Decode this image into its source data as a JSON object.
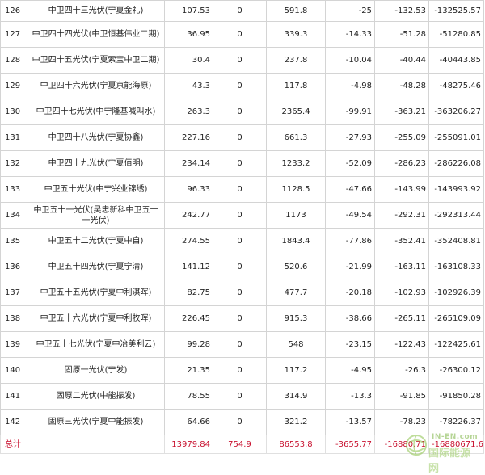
{
  "rows": [
    {
      "id": "126",
      "name": "中卫四十三光伏(宁夏金礼)",
      "capacity": "107.53",
      "zero": "0",
      "val": "591.8",
      "d1": "-25",
      "d2": "-132.53",
      "d3": "-132525.57"
    },
    {
      "id": "127",
      "name": "中卫四十四光伏(中卫恒基伟业二期)",
      "capacity": "36.95",
      "zero": "0",
      "val": "339.3",
      "d1": "-14.33",
      "d2": "-51.28",
      "d3": "-51280.85"
    },
    {
      "id": "128",
      "name": "中卫四十五光伏(宁夏索宝中卫二期)",
      "capacity": "30.4",
      "zero": "0",
      "val": "237.8",
      "d1": "-10.04",
      "d2": "-40.44",
      "d3": "-40443.85"
    },
    {
      "id": "129",
      "name": "中卫四十六光伏(宁夏京能海原)",
      "capacity": "43.3",
      "zero": "0",
      "val": "117.8",
      "d1": "-4.98",
      "d2": "-48.28",
      "d3": "-48275.46"
    },
    {
      "id": "130",
      "name": "中卫四十七光伏(中宁隆基喊叫水)",
      "capacity": "263.3",
      "zero": "0",
      "val": "2365.4",
      "d1": "-99.91",
      "d2": "-363.21",
      "d3": "-363206.27"
    },
    {
      "id": "131",
      "name": "中卫四十八光伏(宁夏协鑫)",
      "capacity": "227.16",
      "zero": "0",
      "val": "661.3",
      "d1": "-27.93",
      "d2": "-255.09",
      "d3": "-255091.01"
    },
    {
      "id": "132",
      "name": "中卫四十九光伏(宁夏佰明)",
      "capacity": "234.14",
      "zero": "0",
      "val": "1233.2",
      "d1": "-52.09",
      "d2": "-286.23",
      "d3": "-286226.08"
    },
    {
      "id": "133",
      "name": "中卫五十光伏(中宁兴业锦绣)",
      "capacity": "96.33",
      "zero": "0",
      "val": "1128.5",
      "d1": "-47.66",
      "d2": "-143.99",
      "d3": "-143993.92"
    },
    {
      "id": "134",
      "name": "中卫五十一光伏(吴忠新科中卫五十一光伏)",
      "capacity": "242.77",
      "zero": "0",
      "val": "1173",
      "d1": "-49.54",
      "d2": "-292.31",
      "d3": "-292313.44"
    },
    {
      "id": "135",
      "name": "中卫五十二光伏(宁夏中自)",
      "capacity": "274.55",
      "zero": "0",
      "val": "1843.4",
      "d1": "-77.86",
      "d2": "-352.41",
      "d3": "-352408.81"
    },
    {
      "id": "136",
      "name": "中卫五十四光伏(宁夏宁清)",
      "capacity": "141.12",
      "zero": "0",
      "val": "520.6",
      "d1": "-21.99",
      "d2": "-163.11",
      "d3": "-163108.33"
    },
    {
      "id": "137",
      "name": "中卫五十五光伏(宁夏中利淇晖)",
      "capacity": "82.75",
      "zero": "0",
      "val": "477.7",
      "d1": "-20.18",
      "d2": "-102.93",
      "d3": "-102926.39"
    },
    {
      "id": "138",
      "name": "中卫五十六光伏(宁夏中利牧晖)",
      "capacity": "226.45",
      "zero": "0",
      "val": "915.3",
      "d1": "-38.66",
      "d2": "-265.11",
      "d3": "-265109.09"
    },
    {
      "id": "139",
      "name": "中卫五十七光伏(宁夏中冶美利云)",
      "capacity": "99.28",
      "zero": "0",
      "val": "548",
      "d1": "-23.15",
      "d2": "-122.43",
      "d3": "-122425.61"
    },
    {
      "id": "140",
      "name": "固原一光伏(宁发)",
      "capacity": "21.35",
      "zero": "0",
      "val": "117.2",
      "d1": "-4.95",
      "d2": "-26.3",
      "d3": "-26300.12"
    },
    {
      "id": "141",
      "name": "固原二光伏(中能振发)",
      "capacity": "78.55",
      "zero": "0",
      "val": "314.9",
      "d1": "-13.3",
      "d2": "-91.85",
      "d3": "-91850.28"
    },
    {
      "id": "142",
      "name": "固原三光伏(宁夏中能振发)",
      "capacity": "64.66",
      "zero": "0",
      "val": "321.2",
      "d1": "-13.57",
      "d2": "-78.23",
      "d3": "-78226.37"
    }
  ],
  "total": {
    "label": "总计",
    "capacity": "13979.84",
    "zero": "754.9",
    "val": "86553.8",
    "d1": "-3655.77",
    "d2": "-16880.71",
    "d3": "-16880671.6"
  },
  "watermark": {
    "en": "IN-EN.com",
    "cn": "国际能源网"
  }
}
